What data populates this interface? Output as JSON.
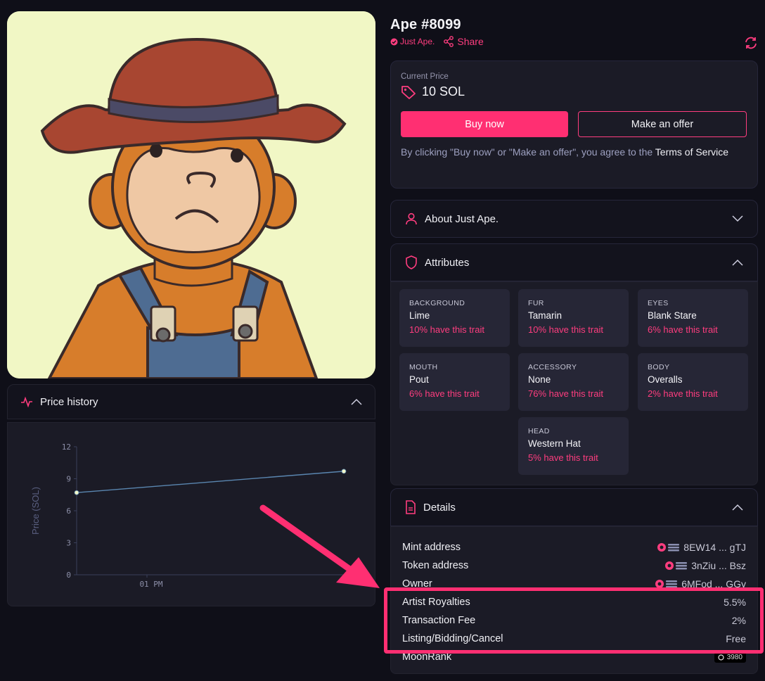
{
  "nft": {
    "name": "Ape #8099",
    "collection": "Just Ape.",
    "share_label": "Share"
  },
  "price": {
    "label": "Current Price",
    "value": "10 SOL"
  },
  "buttons": {
    "buy": "Buy now",
    "offer": "Make an offer"
  },
  "terms": {
    "text": "By clicking \"Buy now\" or \"Make an offer\", you agree to the ",
    "link": "Terms of Service"
  },
  "about": {
    "title": "About Just Ape."
  },
  "attributes": {
    "title": "Attributes",
    "items": [
      {
        "type": "BACKGROUND",
        "value": "Lime",
        "rarity": "10% have this trait"
      },
      {
        "type": "FUR",
        "value": "Tamarin",
        "rarity": "10% have this trait"
      },
      {
        "type": "EYES",
        "value": "Blank Stare",
        "rarity": "6% have this trait"
      },
      {
        "type": "MOUTH",
        "value": "Pout",
        "rarity": "6% have this trait"
      },
      {
        "type": "ACCESSORY",
        "value": "None",
        "rarity": "76% have this trait"
      },
      {
        "type": "BODY",
        "value": "Overalls",
        "rarity": "2% have this trait"
      },
      {
        "type": "HEAD",
        "value": "Western Hat",
        "rarity": "5% have this trait"
      }
    ]
  },
  "details": {
    "title": "Details",
    "rows": [
      {
        "label": "Mint address",
        "value": "8EW14 ... gTJ"
      },
      {
        "label": "Token address",
        "value": "3nZiu ... Bsz"
      },
      {
        "label": "Owner",
        "value": "6MFod ... GGy"
      },
      {
        "label": "Artist Royalties",
        "value": "5.5%"
      },
      {
        "label": "Transaction Fee",
        "value": "2%"
      },
      {
        "label": "Listing/Bidding/Cancel",
        "value": "Free"
      },
      {
        "label": "MoonRank",
        "value": "3980"
      }
    ]
  },
  "price_history": {
    "title": "Price history"
  },
  "colors": {
    "accent": "#ff2f72",
    "background": "#0f0f18",
    "card": "#1b1b26",
    "nft_background": "#f1f7c5"
  },
  "chart_data": {
    "type": "line",
    "ylabel": "Price (SOL)",
    "xlabel": "",
    "ylim": [
      0,
      12
    ],
    "yticks": [
      0,
      3,
      6,
      9,
      12
    ],
    "xticks": [
      "01 PM"
    ],
    "series": [
      {
        "x": [
          0,
          1
        ],
        "values": [
          7.7,
          9.7
        ]
      }
    ]
  }
}
